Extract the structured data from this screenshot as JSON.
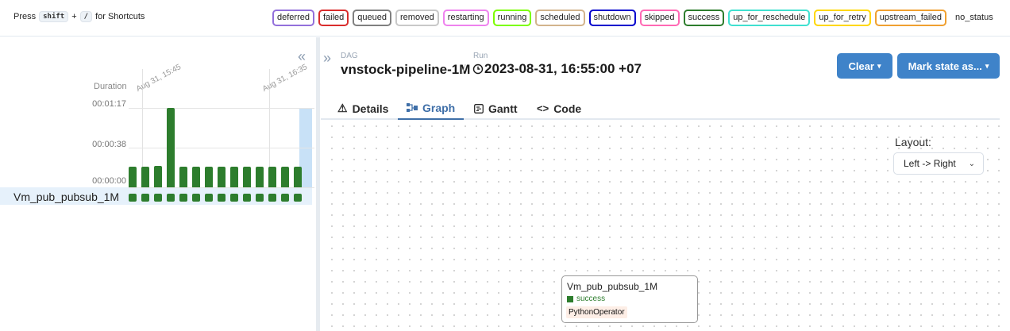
{
  "shortcuts": {
    "prefix": "Press",
    "key1": "shift",
    "plus": "+",
    "key2": "/",
    "suffix": "for Shortcuts"
  },
  "states": [
    {
      "label": "deferred",
      "color": "#9370db"
    },
    {
      "label": "failed",
      "color": "#d92d2d"
    },
    {
      "label": "queued",
      "color": "#808080"
    },
    {
      "label": "removed",
      "color": "#c8c8c8"
    },
    {
      "label": "restarting",
      "color": "#ee82ee"
    },
    {
      "label": "running",
      "color": "#7cfc00"
    },
    {
      "label": "scheduled",
      "color": "#d2b48c"
    },
    {
      "label": "shutdown",
      "color": "#0000cd"
    },
    {
      "label": "skipped",
      "color": "#ff69b4"
    },
    {
      "label": "success",
      "color": "#2d7d2d"
    },
    {
      "label": "up_for_reschedule",
      "color": "#40e0d0"
    },
    {
      "label": "up_for_retry",
      "color": "#ffd700"
    },
    {
      "label": "upstream_failed",
      "color": "#f0a030"
    },
    {
      "label": "no_status",
      "color": "none"
    }
  ],
  "grid": {
    "duration_label": "Duration",
    "ticks": [
      "00:01:17",
      "00:00:38",
      "00:00:00"
    ],
    "dates": [
      "Aug 31, 15:45",
      "Aug 31, 16:35"
    ],
    "task_name": "Vm_pub_pubsub_1M",
    "run_durations_sec": [
      20,
      20,
      21,
      77,
      20,
      20,
      20,
      20,
      20,
      20,
      20,
      20,
      20,
      20
    ],
    "max_duration_sec": 77,
    "selected_run_index": 13,
    "bar_color": "#2d7d2d"
  },
  "header": {
    "dag_caption": "DAG",
    "dag_id": "vnstock-pipeline-1M",
    "separator": "/",
    "run_caption": "Run",
    "run_id": "2023-08-31, 16:55:00 +07",
    "clear_label": "Clear",
    "mark_label": "Mark state as..."
  },
  "tabs": [
    {
      "label": "Details",
      "icon": "warning-icon"
    },
    {
      "label": "Graph",
      "icon": "graph-icon",
      "active": true
    },
    {
      "label": "Gantt",
      "icon": "gantt-icon"
    },
    {
      "label": "Code",
      "icon": "code-icon"
    }
  ],
  "graph": {
    "layout_label": "Layout:",
    "layout_value": "Left -> Right",
    "node": {
      "title": "Vm_pub_pubsub_1M",
      "state": "success",
      "operator": "PythonOperator"
    }
  }
}
